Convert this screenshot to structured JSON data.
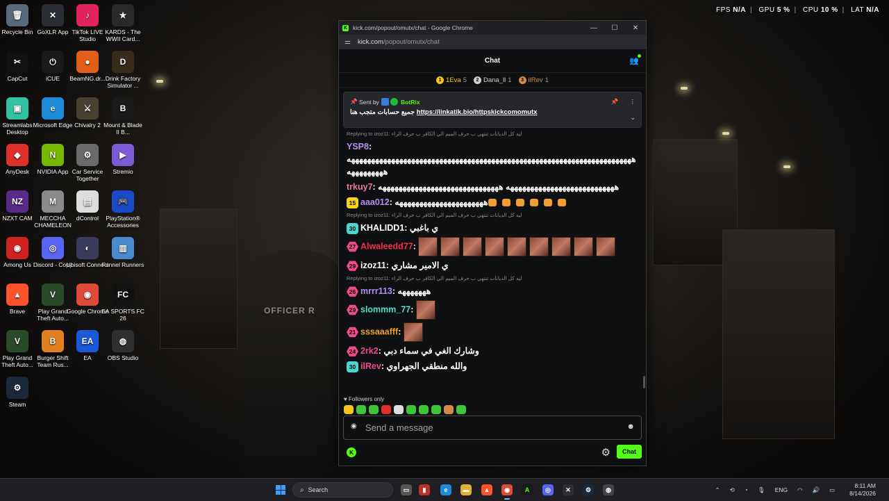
{
  "desktop": {
    "icons": [
      {
        "label": "Recycle Bin",
        "color": "#5a6a7a",
        "glyph": "🗑"
      },
      {
        "label": "GoXLR App",
        "color": "#2b2f35",
        "glyph": "✕"
      },
      {
        "label": "TikTok LIVE Studio",
        "color": "#e0245e",
        "glyph": "♪"
      },
      {
        "label": "KARDS - The WWII Card...",
        "color": "#2a2a2a",
        "glyph": "★"
      },
      {
        "label": "CapCut",
        "color": "#111111",
        "glyph": "✂"
      },
      {
        "label": "iCUE",
        "color": "#1a1a1a",
        "glyph": "⏻"
      },
      {
        "label": "BeamNG.dr...",
        "color": "#e0601a",
        "glyph": "●"
      },
      {
        "label": "Drink Factory Simulator ...",
        "color": "#3a2a1a",
        "glyph": "D"
      },
      {
        "label": "Streamlabs Desktop",
        "color": "#31c3a2",
        "glyph": "▣"
      },
      {
        "label": "Microsoft Edge",
        "color": "#1f8ad8",
        "glyph": "e"
      },
      {
        "label": "Chivalry 2",
        "color": "#4a4030",
        "glyph": "⚔"
      },
      {
        "label": "Mount & Blade II B...",
        "color": "#1a1a1a",
        "glyph": "B"
      },
      {
        "label": "AnyDesk",
        "color": "#e0302a",
        "glyph": "◆"
      },
      {
        "label": "NVIDIA App",
        "color": "#76b900",
        "glyph": "N"
      },
      {
        "label": "Car Service Together",
        "color": "#6a6a6a",
        "glyph": "⚙"
      },
      {
        "label": "Stremio",
        "color": "#7b5bd6",
        "glyph": "▶"
      },
      {
        "label": "NZXT CAM",
        "color": "#5a2a8a",
        "glyph": "NZ"
      },
      {
        "label": "MECCHA CHAMELEON",
        "color": "#8a8a8a",
        "glyph": "M"
      },
      {
        "label": "dControl",
        "color": "#dddddd",
        "glyph": "▤"
      },
      {
        "label": "PlayStation® Accessories",
        "color": "#1a4ac8",
        "glyph": "🎮"
      },
      {
        "label": "Among Us",
        "color": "#d02020",
        "glyph": "◉"
      },
      {
        "label": "Discord - Copy",
        "color": "#5865f2",
        "glyph": "◎"
      },
      {
        "label": "Ubisoft Connect",
        "color": "#3a3a5a",
        "glyph": "◐"
      },
      {
        "label": "Funnel Runners",
        "color": "#4a8ad0",
        "glyph": "▥"
      },
      {
        "label": "Brave",
        "color": "#fb542b",
        "glyph": "▲"
      },
      {
        "label": "Play Grand Theft Auto...",
        "color": "#2a4a2a",
        "glyph": "V"
      },
      {
        "label": "Google Chrome",
        "color": "#dd4b39",
        "glyph": "◉"
      },
      {
        "label": "EA SPORTS FC 26",
        "color": "#111111",
        "glyph": "FC"
      },
      {
        "label": "Play Grand Theft Auto...",
        "color": "#2a4a2a",
        "glyph": "V"
      },
      {
        "label": "Burger Shift Team Rus...",
        "color": "#e08020",
        "glyph": "B"
      },
      {
        "label": "EA",
        "color": "#1a5ad8",
        "glyph": "EA"
      },
      {
        "label": "OBS Studio",
        "color": "#302e31",
        "glyph": "◍"
      },
      {
        "label": "Steam",
        "color": "#1b2838",
        "glyph": "⚙"
      }
    ],
    "scene_text": "OFFICER R"
  },
  "overlay": {
    "fps_label": "FPS",
    "fps": "N/A",
    "gpu_label": "GPU",
    "gpu": "5 %",
    "cpu_label": "CPU",
    "cpu": "10 %",
    "lat_label": "LAT",
    "lat": "N/A"
  },
  "browser": {
    "title": "kick.com/popout/omutx/chat - Google Chrome",
    "url_host": "kick.com",
    "url_path": "/popout/omutx/chat"
  },
  "chat": {
    "header": "Chat",
    "top_gifters": [
      {
        "rank": "1",
        "name": "1Eva",
        "count": "5",
        "color": "#f5c518"
      },
      {
        "rank": "2",
        "name": "Dana_ll",
        "count": "1",
        "color": "#d0d0d0"
      },
      {
        "rank": "3",
        "name": "ilRev",
        "count": "1",
        "color": "#d08a4a"
      }
    ],
    "pinned": {
      "sent_by_label": "Sent by",
      "bot_name": "BotRix",
      "text_ar": "جميع حسابات متجب هنا",
      "link": "https://linkatik.bio/httpskickcomomutx"
    },
    "messages": [
      {
        "type": "reply",
        "text": "Replying to izoz11: ليه كل الديانات تنتهي ب حرف الميم الي الكافر ب حرف الراء"
      },
      {
        "type": "msg",
        "user": "YSP8",
        "color": "#b48ef5",
        "body": "هههههههههههههههههههههههههههههههههههههههههههههههههههههههههههههههههههههههه هههههههههه"
      },
      {
        "type": "msg",
        "user": "trkuy7",
        "color": "#e87a9a",
        "body": "هههههههههههههههههههههههههههه ههههههههههههههههههههههههههههههه"
      },
      {
        "type": "msg",
        "sub": "15",
        "subcolor": "#f5d518",
        "user": "aaa012",
        "color": "#b48ef5",
        "body": "ههههههههههههههههههههههه"
      },
      {
        "type": "reply",
        "text": "Replying to izoz11: ليه كل الديانات تنتهي ب حرف الميم الي الكافر ب حرف الراء"
      },
      {
        "type": "msg",
        "sub": "30",
        "subcolor": "#4ad6d0",
        "user": "KHALIDD1",
        "color": "#ffffff",
        "body": "ي باغبي"
      },
      {
        "type": "msg",
        "sub": "27",
        "subcolor": "#f04a8a",
        "user": "Alwaleedd77",
        "color": "#f0304a",
        "body": ""
      },
      {
        "type": "msg",
        "sub": "29",
        "subcolor": "#f04a8a",
        "user": "izoz11",
        "color": "#ffffff",
        "body": "ي الامير مشاري"
      },
      {
        "type": "reply",
        "text": "Replying to izoz11: ليه كل الديانات تنتهي ب حرف الميم الي الكافر ب حرف الراء"
      },
      {
        "type": "msg",
        "sub": "26",
        "subcolor": "#f04a8a",
        "user": "mrrr113",
        "color": "#b48ef5",
        "body": "هههههههه"
      },
      {
        "type": "msg",
        "sub": "29",
        "subcolor": "#f04a8a",
        "user": "slommm_77",
        "color": "#4ae0d0",
        "body": ""
      },
      {
        "type": "msg",
        "sub": "21",
        "subcolor": "#f04a8a",
        "user": "sssaaafff",
        "color": "#f0a020",
        "body": ""
      },
      {
        "type": "msg",
        "sub": "24",
        "subcolor": "#f04a8a",
        "user": "2rk2",
        "color": "#f04a8a",
        "body": "وشارك الغي في سماء دبي"
      },
      {
        "type": "msg",
        "sub": "30",
        "subcolor": "#4ad6d0",
        "user": "ilRev",
        "color": "#f04a8a",
        "body": "والله منطقي الجهراوي"
      }
    ],
    "followers_only": "Followers only",
    "input_placeholder": "Send a message",
    "send_button": "Chat"
  },
  "taskbar": {
    "search_placeholder": "Search",
    "lang": "ENG",
    "time": "8:11 AM",
    "date": "8/14/2026"
  }
}
